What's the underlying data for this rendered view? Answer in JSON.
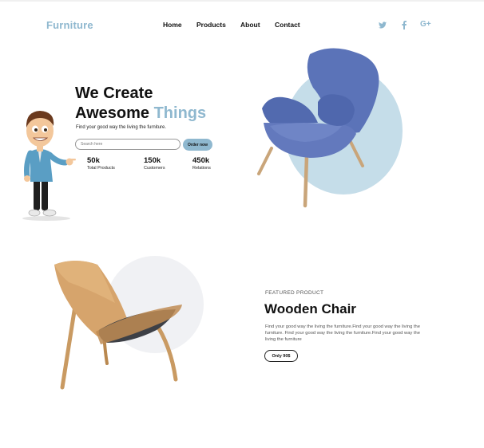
{
  "header": {
    "logo": "Furniture",
    "nav": [
      "Home",
      "Products",
      "About",
      "Contact"
    ],
    "social_icons": [
      "twitter-icon",
      "facebook-icon",
      "google-plus-icon"
    ],
    "social_glyphs": [
      "🐦",
      "f",
      "G+"
    ]
  },
  "hero": {
    "title_line1": "We Create",
    "title_line2_plain": "Awesome ",
    "title_line2_accent": "Things",
    "subtitle": "Find your good way the living the furniture.",
    "search_placeholder": "Search here",
    "order_button": "Order now",
    "stats": [
      {
        "value": "50k",
        "label": "Total Products"
      },
      {
        "value": "150k",
        "label": "Customers"
      },
      {
        "value": "450k",
        "label": "Relations"
      }
    ]
  },
  "featured": {
    "label": "FEATURED PRODUCT",
    "title": "Wooden Chair",
    "description": "Find your good way the living the furniture.Find your good way the living the furniture. Find your good way the living the furniture.Find your good way the living the furniture",
    "price_button": "Only 90$"
  },
  "colors": {
    "accent": "#8fb8cf",
    "armchair": "#5b73b8",
    "wood": "#c99a62"
  }
}
